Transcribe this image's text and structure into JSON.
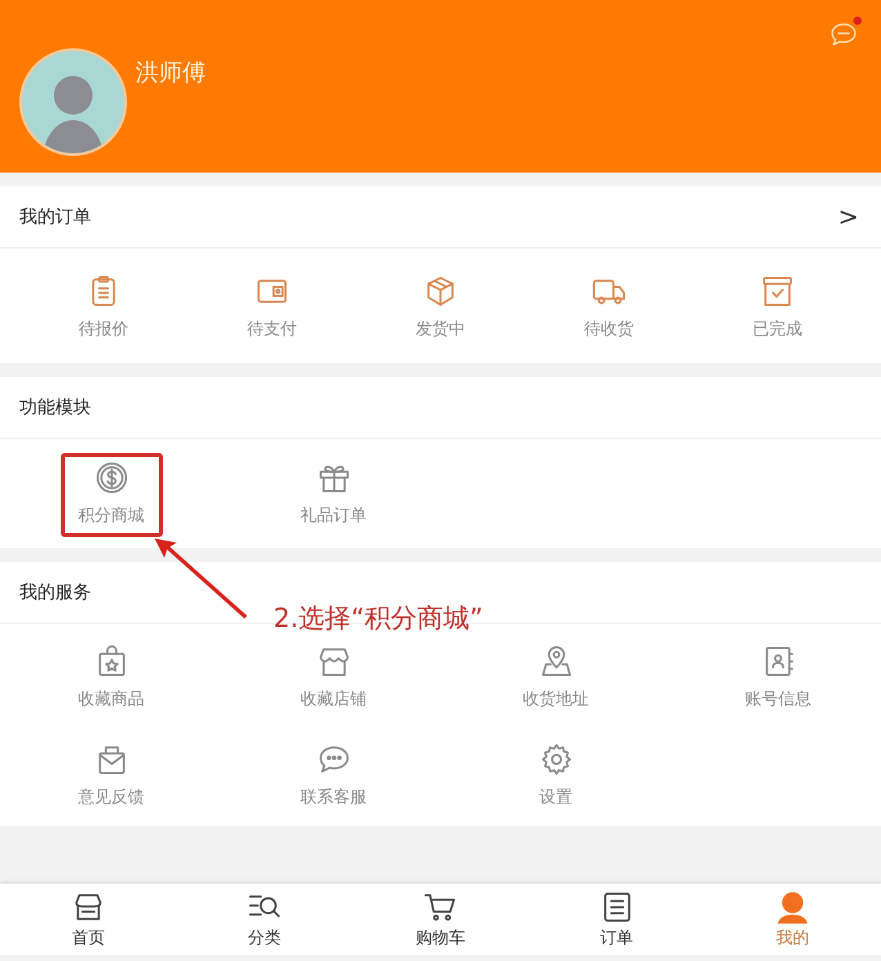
{
  "profile": {
    "name": "洪师傅",
    "message_badge": true
  },
  "orders": {
    "title": "我的订单",
    "more": ">",
    "items": [
      {
        "label": "待报价"
      },
      {
        "label": "待支付"
      },
      {
        "label": "发货中"
      },
      {
        "label": "待收货"
      },
      {
        "label": "已完成"
      }
    ]
  },
  "functions": {
    "title": "功能模块",
    "items": [
      {
        "label": "积分商城",
        "highlighted": true
      },
      {
        "label": "礼品订单",
        "highlighted": false
      }
    ]
  },
  "services": {
    "title": "我的服务",
    "items": [
      {
        "label": "收藏商品"
      },
      {
        "label": "收藏店铺"
      },
      {
        "label": "收货地址"
      },
      {
        "label": "账号信息"
      },
      {
        "label": "意见反馈"
      },
      {
        "label": "联系客服"
      },
      {
        "label": "设置"
      }
    ]
  },
  "annotation": {
    "text": "2.选择“积分商城”"
  },
  "nav": [
    {
      "label": "首页",
      "selected": false
    },
    {
      "label": "分类",
      "selected": false
    },
    {
      "label": "购物车",
      "selected": false
    },
    {
      "label": "订单",
      "selected": false
    },
    {
      "label": "我的",
      "selected": true
    }
  ]
}
